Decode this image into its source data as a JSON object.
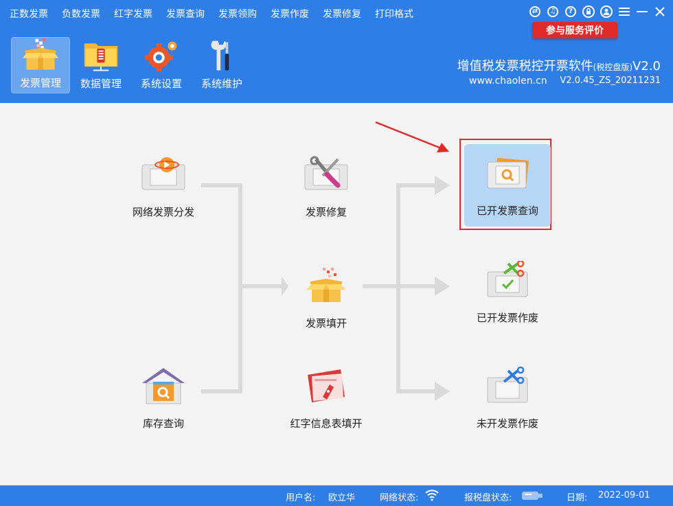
{
  "menu": [
    "正数发票",
    "负数发票",
    "红字发票",
    "发票查询",
    "发票领购",
    "发票作废",
    "发票修复",
    "打印格式"
  ],
  "window_controls": [
    "transfer-icon",
    "headset-icon",
    "help-icon",
    "lock-icon",
    "user-icon",
    "menu-icon",
    "minimize-icon",
    "close-icon"
  ],
  "evaluate_button": "参与服务评价",
  "toolbar": [
    {
      "label": "发票管理",
      "icon": "invoice-box-icon",
      "active": true
    },
    {
      "label": "数据管理",
      "icon": "folder-icon",
      "active": false
    },
    {
      "label": "系统设置",
      "icon": "gear-icon",
      "active": false
    },
    {
      "label": "系统维护",
      "icon": "tools-icon",
      "active": false
    }
  ],
  "app": {
    "title": "增值税发票税控开票软件",
    "edition": "(税控盘版)",
    "version_short": "V2.0",
    "url": "www.chaolen.cn",
    "version": "V2.0.45_ZS_20211231"
  },
  "functions": {
    "network_distribute": "网络发票分发",
    "inventory_query": "库存查询",
    "invoice_repair": "发票修复",
    "invoice_fill": "发票填开",
    "red_info_fill": "红字信息表填开",
    "issued_query": "已开发票查询",
    "issued_void": "已开发票作废",
    "unissued_void": "未开发票作废"
  },
  "status": {
    "user_label": "用户名:",
    "user_value": "欧立华",
    "network_label": "网络状态:",
    "tax_disk_label": "报税盘状态:",
    "date_label": "日期:",
    "date_value": "2022-09-01"
  },
  "colors": {
    "header": "#2f7ee6",
    "accent_red": "#e02a2a",
    "highlight": "#b6d6f5"
  }
}
